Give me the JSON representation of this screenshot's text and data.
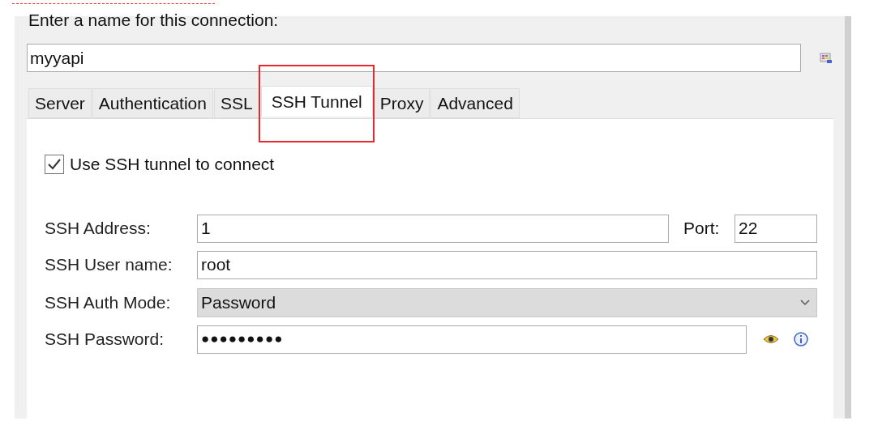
{
  "connection_name": {
    "label": "Enter a name for this connection:",
    "value": "myyapi"
  },
  "tabs": [
    {
      "label": "Server",
      "selected": false,
      "highlighted": false
    },
    {
      "label": "Authentication",
      "selected": false,
      "highlighted": false
    },
    {
      "label": "SSL",
      "selected": false,
      "highlighted": false
    },
    {
      "label": "SSH Tunnel",
      "selected": true,
      "highlighted": true
    },
    {
      "label": "Proxy",
      "selected": false,
      "highlighted": false
    },
    {
      "label": "Advanced",
      "selected": false,
      "highlighted": false
    }
  ],
  "use_ssh": {
    "label": "Use SSH tunnel to connect",
    "checked": true
  },
  "ssh_address": {
    "label": "SSH Address:",
    "value": "1"
  },
  "port": {
    "label": "Port:",
    "value": "22"
  },
  "ssh_user": {
    "label": "SSH User name:",
    "value": "root"
  },
  "auth_mode": {
    "label": "SSH Auth Mode:",
    "value": "Password"
  },
  "ssh_password": {
    "label": "SSH Password:",
    "value": "●●●●●●●●●"
  }
}
